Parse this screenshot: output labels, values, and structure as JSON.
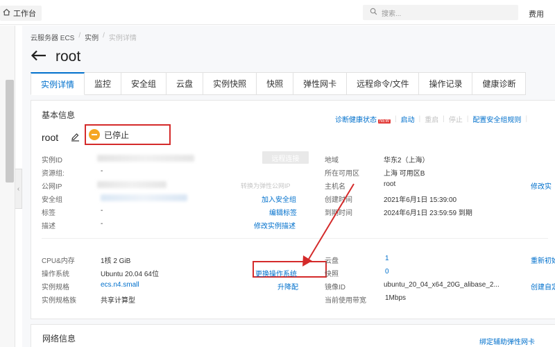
{
  "topbar": {
    "workbench_label": "工作台",
    "search_placeholder": "搜索...",
    "fee_label": "费用"
  },
  "breadcrumb": [
    "云服务器 ECS",
    "实例",
    "实例详情"
  ],
  "page_title": "root",
  "tabs": [
    "实例详情",
    "监控",
    "安全组",
    "云盘",
    "实例快照",
    "快照",
    "弹性网卡",
    "远程命令/文件",
    "操作记录",
    "健康诊断"
  ],
  "basic": {
    "heading": "基本信息",
    "actions": {
      "diagnose": "诊断健康状态",
      "new_badge": "NEW",
      "start": "启动",
      "restart": "重启",
      "stop": "停止",
      "config_sg": "配置安全组规则"
    },
    "instance_name": "root",
    "status": "已停止",
    "remote_connect": "远程连接",
    "labels": {
      "instance_id": "实例ID",
      "resource_group": "资源组:",
      "public_ip": "公网IP",
      "security_group": "安全组",
      "tags": "标签",
      "description": "描述",
      "region": "地域",
      "zone": "所在可用区",
      "hostname": "主机名",
      "created": "创建时间",
      "expires": "到期时间"
    },
    "values": {
      "resource_group": "-",
      "tags": "-",
      "description": "-",
      "region": "华东2（上海）",
      "zone": "上海 可用区B",
      "hostname": "root",
      "created": "2021年6月1日 15:39:00",
      "expires": "2024年6月1日 23:59:59 到期"
    },
    "links": {
      "convert_eip": "转换为弹性公网IP",
      "add_sg": "加入安全组",
      "edit_tags": "编辑标签",
      "edit_desc": "修改实例描述",
      "modify": "修改实",
      "sg_partial": ".10098"
    }
  },
  "spec": {
    "labels": {
      "cpu_mem": "CPU&内存",
      "os": "操作系统",
      "type": "实例规格",
      "family": "实例规格族",
      "disk": "云盘",
      "snapshot": "快照",
      "image_id": "镜像ID",
      "bandwidth": "当前使用带宽"
    },
    "values": {
      "cpu_mem": "1核 2 GiB",
      "os": "Ubuntu 20.04 64位",
      "type": "ecs.n4.small",
      "family": "共享计算型",
      "disk": "1",
      "snapshot": "0",
      "image_id": "ubuntu_20_04_x64_20G_alibase_2...",
      "bandwidth": "1Mbps"
    },
    "links": {
      "change_os": "更换操作系统",
      "upgrade": "升降配",
      "reinit": "重新初始",
      "create_custom": "创建自定"
    }
  },
  "network": {
    "heading": "网络信息",
    "bind_eni": "绑定辅助弹性网卡"
  },
  "colors": {
    "link": "#0070cc",
    "highlight": "#d42a2a",
    "stopped": "#f5a623"
  }
}
